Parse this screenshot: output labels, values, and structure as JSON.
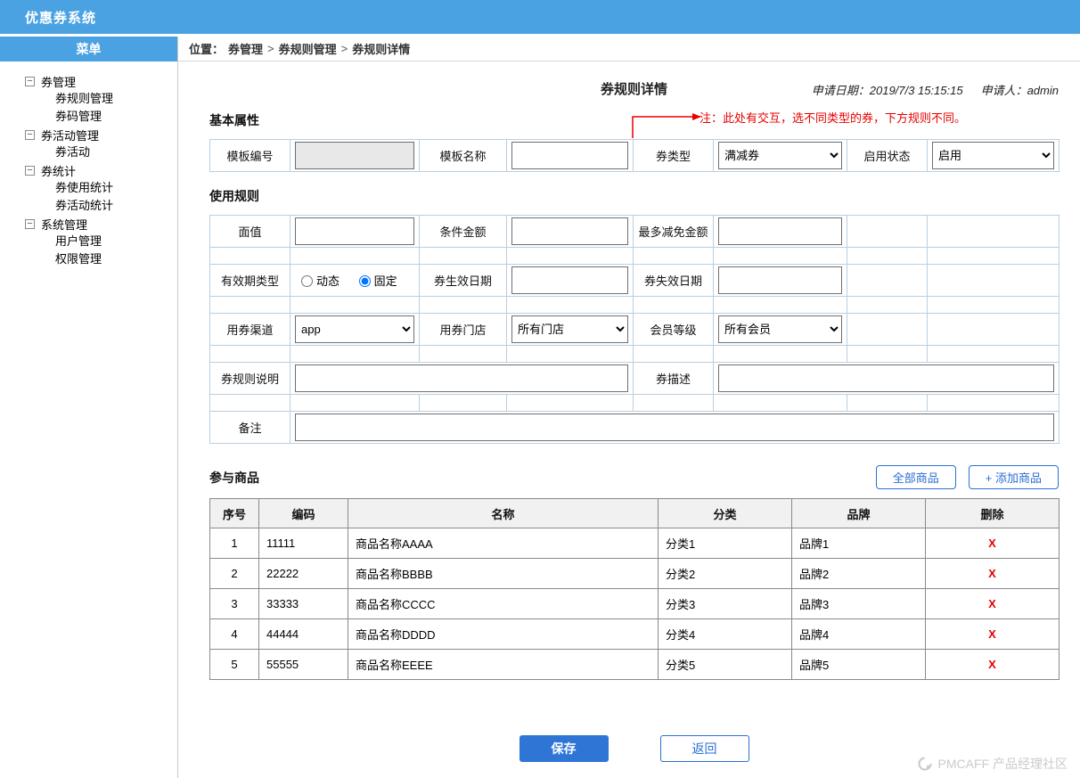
{
  "app": {
    "title": "优惠券系统"
  },
  "colors": {
    "header_blue": "#4ba2e2",
    "accent_blue": "#2a6fd2",
    "save_blue": "#2e75d5",
    "note_red": "#e60000",
    "watermark_gray": "#cbcbcb"
  },
  "sidebar": {
    "header": "菜单",
    "groups": [
      {
        "label": "券管理",
        "children": [
          "券规则管理",
          "券码管理"
        ]
      },
      {
        "label": "券活动管理",
        "children": [
          "券活动"
        ]
      },
      {
        "label": "券统计",
        "children": [
          "券使用统计",
          "券活动统计"
        ]
      },
      {
        "label": "系统管理",
        "children": [
          "用户管理",
          "权限管理"
        ]
      }
    ]
  },
  "breadcrumb": {
    "prefix": "位置：",
    "separator": ">",
    "items": [
      "券管理",
      "券规则管理",
      "券规则详情"
    ]
  },
  "page": {
    "title": "券规则详情",
    "apply_date_label": "申请日期：2019/7/3 15:15:15",
    "applicant_label": "申请人：admin"
  },
  "note": "注：此处有交互，选不同类型的券，下方规则不同。",
  "sections": {
    "basic": "基本属性",
    "rules": "使用规则",
    "products": "参与商品"
  },
  "form": {
    "template_code_label": "模板编号",
    "template_name_label": "模板名称",
    "coupon_type_label": "券类型",
    "coupon_type_value": "满减券",
    "status_label": "启用状态",
    "status_value": "启用",
    "face_value_label": "面值",
    "condition_amount_label": "条件金额",
    "max_discount_label": "最多减免金额",
    "validity_type_label": "有效期类型",
    "radio_dynamic": "动态",
    "radio_fixed": "固定",
    "effective_date_label": "券生效日期",
    "expire_date_label": "券失效日期",
    "channel_label": "用券渠道",
    "channel_value": "app",
    "store_label": "用券门店",
    "store_value": "所有门店",
    "member_label": "会员等级",
    "member_value": "所有会员",
    "rule_desc_label": "券规则说明",
    "coupon_desc_label": "券描述",
    "remark_label": "备注"
  },
  "products": {
    "all_button": "全部商品",
    "add_button": "+ 添加商品",
    "columns": [
      "序号",
      "编码",
      "名称",
      "分类",
      "品牌",
      "删除"
    ],
    "rows": [
      [
        "1",
        "11111",
        "商品名称AAAA",
        "分类1",
        "品牌1",
        "X"
      ],
      [
        "2",
        "22222",
        "商品名称BBBB",
        "分类2",
        "品牌2",
        "X"
      ],
      [
        "3",
        "33333",
        "商品名称CCCC",
        "分类3",
        "品牌3",
        "X"
      ],
      [
        "4",
        "44444",
        "商品名称DDDD",
        "分类4",
        "品牌4",
        "X"
      ],
      [
        "5",
        "55555",
        "商品名称EEEE",
        "分类5",
        "品牌5",
        "X"
      ]
    ]
  },
  "actions": {
    "save": "保存",
    "back": "返回"
  },
  "watermark": "PMCAFF 产品经理社区"
}
